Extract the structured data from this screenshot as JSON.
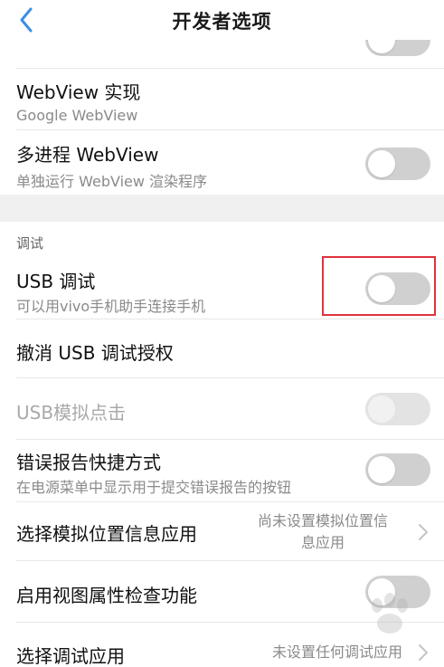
{
  "header": {
    "title": "开发者选项"
  },
  "items": [
    {
      "title": "WebView 实现",
      "subtitle": "Google WebView"
    },
    {
      "title": "多进程 WebView",
      "subtitle": "单独运行 WebView 渲染程序",
      "toggle": false
    },
    {
      "section": "调试"
    },
    {
      "title": "USB 调试",
      "subtitle": "可以用vivo手机助手连接手机",
      "toggle": false,
      "highlighted": true
    },
    {
      "title": "撤消 USB 调试授权"
    },
    {
      "title": "USB模拟点击",
      "toggle": false,
      "disabled": true
    },
    {
      "title": "错误报告快捷方式",
      "subtitle": "在电源菜单中显示用于提交错误报告的按钮",
      "toggle": false
    },
    {
      "title": "选择模拟位置信息应用",
      "value_line1": "尚未设置模拟位置信",
      "value_line2": "息应用"
    },
    {
      "title": "启用视图属性检查功能",
      "toggle": false
    },
    {
      "title": "选择调试应用",
      "value": "未设置任何调试应用"
    }
  ],
  "colors": {
    "highlight": "#e0333c",
    "accent_back": "#3a8ee6",
    "toggle_off": "#d0d0d0",
    "section_bg": "#f0f0f0"
  },
  "icons": {
    "back": "chevron-left-icon",
    "chevron": "chevron-right-icon",
    "watermark": "baidu-paw-icon"
  }
}
